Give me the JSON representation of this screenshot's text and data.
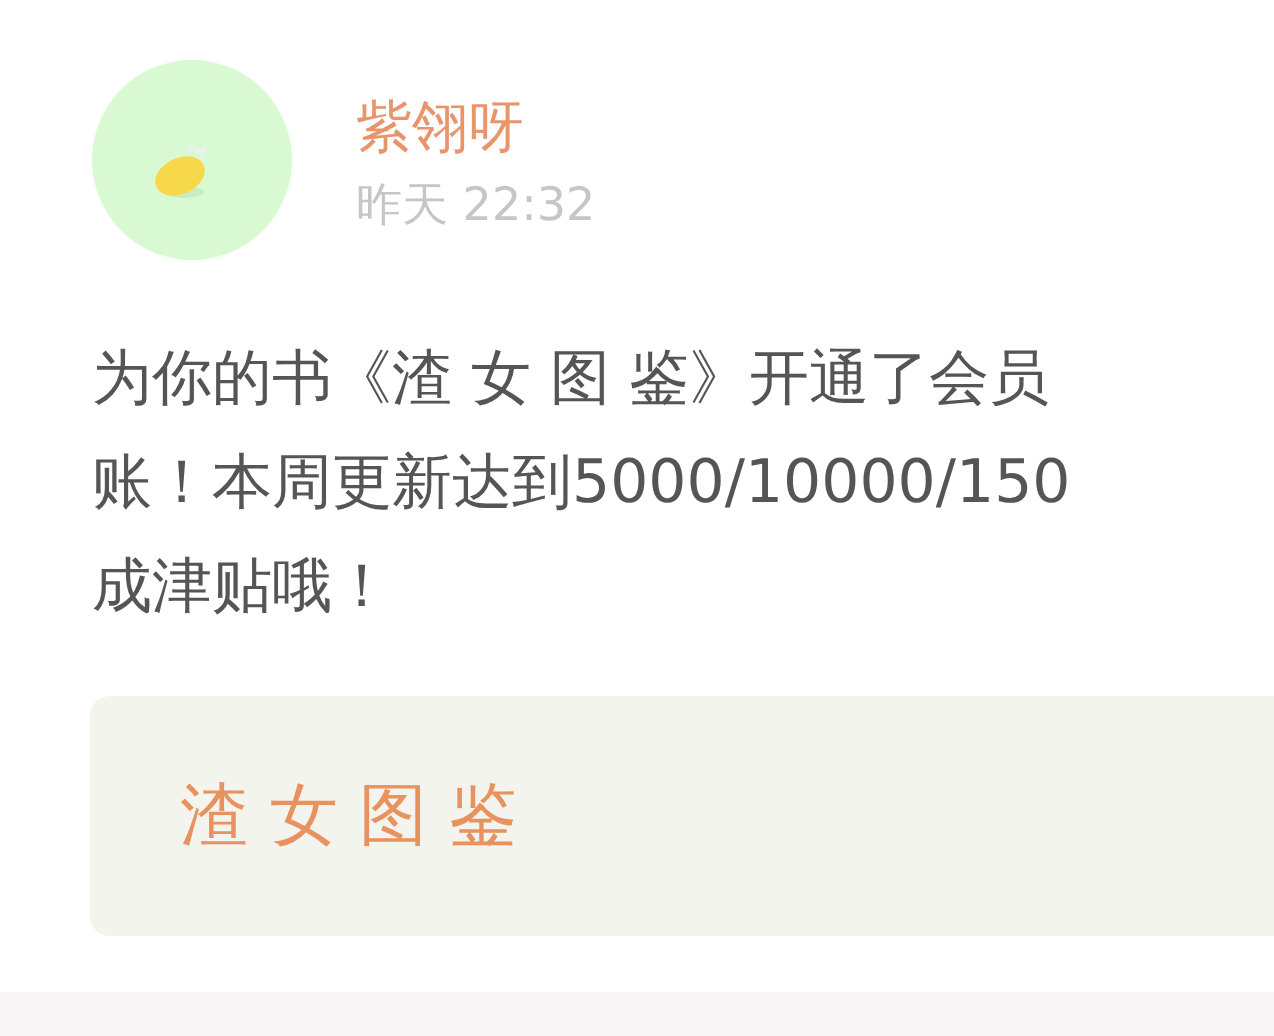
{
  "post": {
    "author": "紫翎呀",
    "time": "昨天 22:32",
    "message_lines": [
      "为你的书《渣 女 图 鉴》开通了会员",
      "账！本周更新达到5000/10000/150",
      "成津贴哦！"
    ],
    "book_card": {
      "title": "渣 女 图 鉴"
    }
  }
}
